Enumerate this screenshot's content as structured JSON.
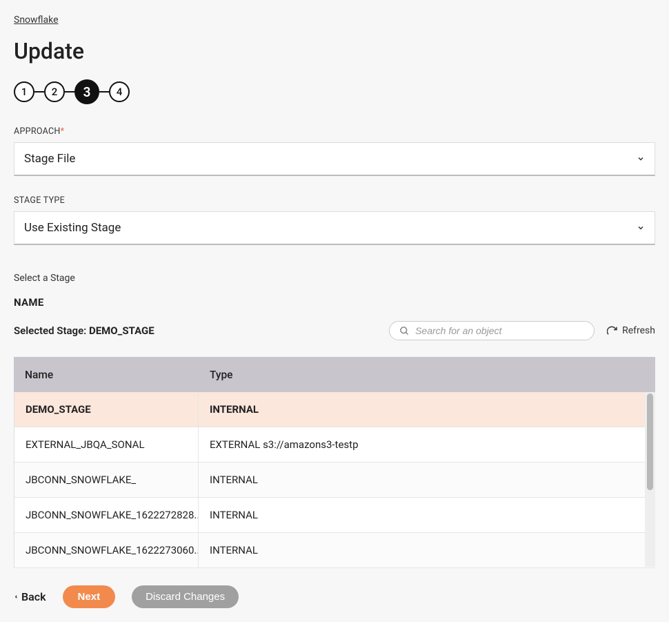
{
  "breadcrumb": "Snowflake",
  "page_title": "Update",
  "stepper": {
    "steps": [
      "1",
      "2",
      "3",
      "4"
    ],
    "active_index": 2
  },
  "approach": {
    "label": "APPROACH",
    "required_marker": "*",
    "value": "Stage File"
  },
  "stage_type": {
    "label": "STAGE TYPE",
    "value": "Use Existing Stage"
  },
  "select_stage_label": "Select a Stage",
  "name_heading": "NAME",
  "selected_stage": {
    "prefix": "Selected Stage: ",
    "value": "DEMO_STAGE"
  },
  "search": {
    "placeholder": "Search for an object"
  },
  "refresh_label": "Refresh",
  "table": {
    "columns": {
      "name": "Name",
      "type": "Type"
    },
    "rows": [
      {
        "name": "DEMO_STAGE",
        "type": "INTERNAL",
        "selected": true
      },
      {
        "name": "EXTERNAL_JBQA_SONAL",
        "type": "EXTERNAL s3://amazons3-testp",
        "selected": false
      },
      {
        "name": "JBCONN_SNOWFLAKE_",
        "type": "INTERNAL",
        "selected": false
      },
      {
        "name": "JBCONN_SNOWFLAKE_1622272828...",
        "type": "INTERNAL",
        "selected": false
      },
      {
        "name": "JBCONN_SNOWFLAKE_1622273060...",
        "type": "INTERNAL",
        "selected": false
      }
    ]
  },
  "footer": {
    "back": "Back",
    "next": "Next",
    "discard": "Discard Changes"
  }
}
